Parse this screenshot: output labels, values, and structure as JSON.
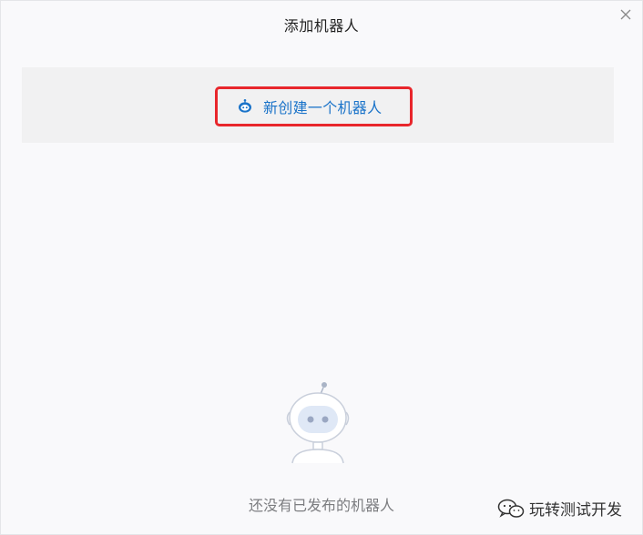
{
  "dialog": {
    "title": "添加机器人",
    "close_icon": "close-icon"
  },
  "create": {
    "label": "新创建一个机器人",
    "icon": "robot-icon",
    "accent": "#1a73c9",
    "highlight": "#e8262c"
  },
  "empty_state": {
    "illustration": "robot-illustration",
    "text": "还没有已发布的机器人"
  },
  "watermark": {
    "icon": "wechat-icon",
    "text": "玩转测试开发"
  }
}
